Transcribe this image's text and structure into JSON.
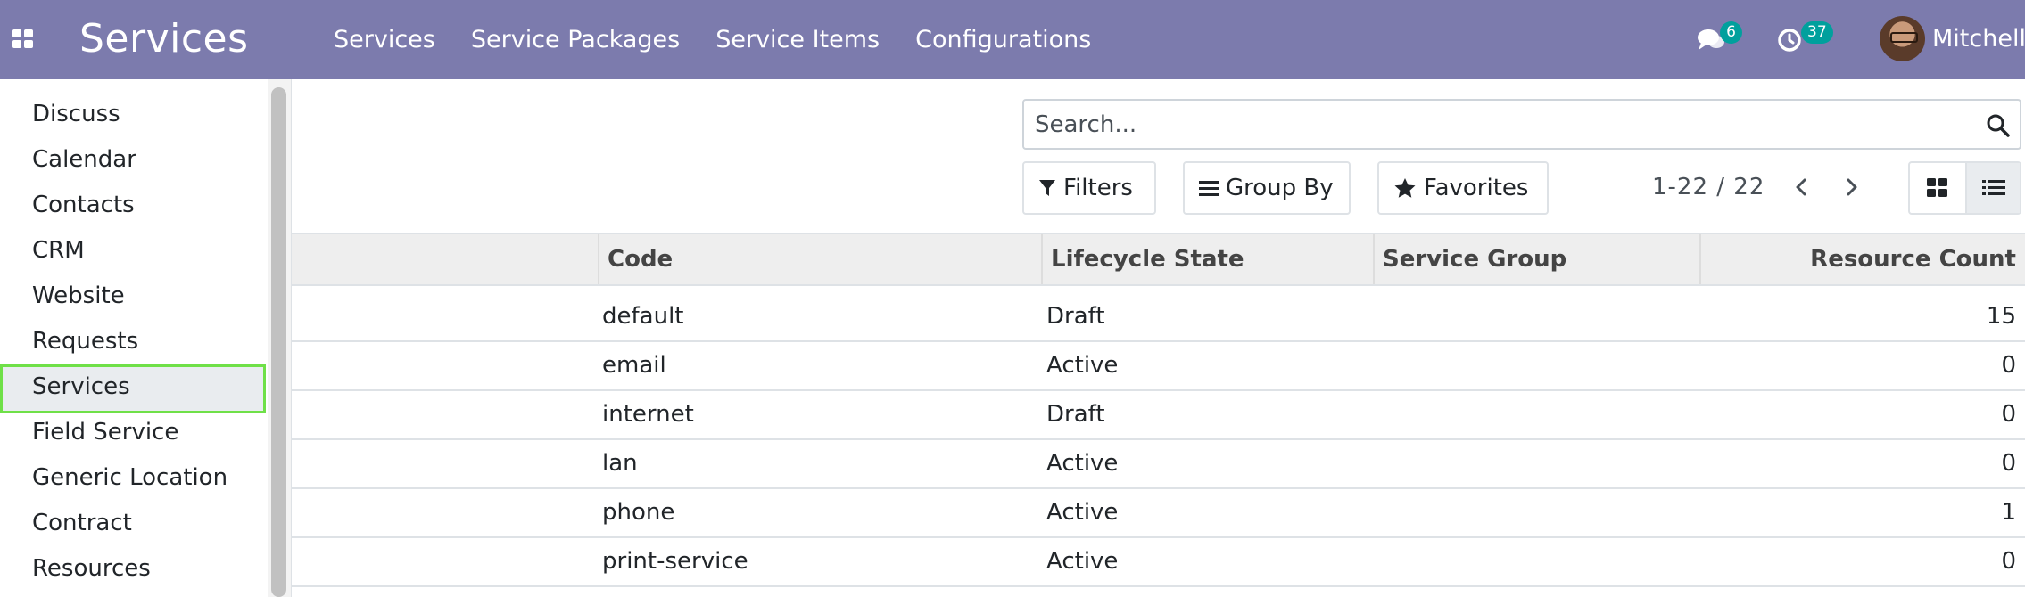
{
  "navbar": {
    "brand": "Services",
    "menu": [
      "Services",
      "Service Packages",
      "Service Items",
      "Configurations"
    ],
    "messages_count": "6",
    "activities_count": "37",
    "user_name": "Mitchell",
    "bg_color": "#7c7bad",
    "badge_color": "#00a09d"
  },
  "sidebar": {
    "items": [
      "Discuss",
      "Calendar",
      "Contacts",
      "CRM",
      "Website",
      "Requests",
      "Services",
      "Field Service",
      "Generic Location",
      "Contract",
      "Resources"
    ],
    "active_item": "Services",
    "active_border_color": "#6fe048"
  },
  "search": {
    "placeholder": "Search..."
  },
  "controls": {
    "filters": "Filters",
    "group_by": "Group By",
    "favorites": "Favorites",
    "pager": "1-22 / 22"
  },
  "table": {
    "columns": [
      "Code",
      "Lifecycle State",
      "Service Group",
      "Resource Count"
    ],
    "rows": [
      {
        "code": "default",
        "state": "Draft",
        "group": "",
        "count": "15"
      },
      {
        "code": "email",
        "state": "Active",
        "group": "",
        "count": "0"
      },
      {
        "code": "internet",
        "state": "Draft",
        "group": "",
        "count": "0"
      },
      {
        "code": "lan",
        "state": "Active",
        "group": "",
        "count": "0"
      },
      {
        "code": "phone",
        "state": "Active",
        "group": "",
        "count": "1"
      },
      {
        "code": "print-service",
        "state": "Active",
        "group": "",
        "count": "0"
      }
    ]
  }
}
